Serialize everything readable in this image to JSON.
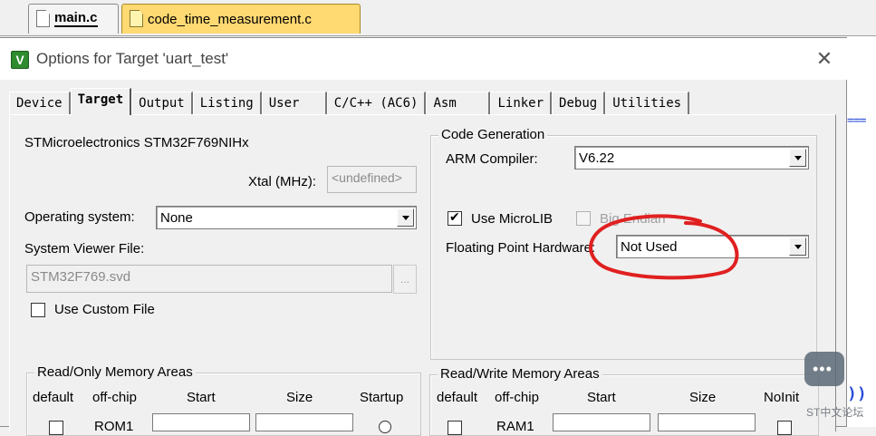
{
  "editor_tabs": [
    {
      "label": "main.c"
    },
    {
      "label": "code_time_measurement.c"
    }
  ],
  "dialog": {
    "title": "Options for Target 'uart_test'",
    "close_glyph": "✕",
    "tabs": [
      "Device",
      "Target",
      "Output",
      "Listing",
      "User",
      "C/C++ (AC6)",
      "Asm",
      "Linker",
      "Debug",
      "Utilities"
    ],
    "active_tab": "Target"
  },
  "target": {
    "device_name": "STMicroelectronics STM32F769NIHx",
    "xtal_label": "Xtal (MHz):",
    "xtal_value": "<undefined>",
    "os_label": "Operating system:",
    "os_value": "None",
    "svd_label": "System Viewer File:",
    "svd_value": "STM32F769.svd",
    "browse_label": "...",
    "custom_file_label": "Use Custom File",
    "custom_file_checked": false
  },
  "code_generation": {
    "legend": "Code Generation",
    "compiler_label": "ARM Compiler:",
    "compiler_value": "V6.22",
    "microlib_label": "Use MicroLIB",
    "microlib_checked": true,
    "big_endian_label": "Big Endian",
    "big_endian_checked": false,
    "fph_label": "Floating Point Hardware:",
    "fph_value": "Not Used"
  },
  "ro_memory": {
    "legend": "Read/Only Memory Areas",
    "headers": [
      "default",
      "off-chip",
      "Start",
      "Size",
      "Startup"
    ],
    "rows": [
      {
        "name": "ROM1"
      }
    ]
  },
  "rw_memory": {
    "legend": "Read/Write Memory Areas",
    "headers": [
      "default",
      "off-chip",
      "Start",
      "Size",
      "NoInit"
    ],
    "rows": [
      {
        "name": "RAM1"
      }
    ]
  },
  "watermark": {
    "text": "ST中文论坛"
  },
  "colors": {
    "annotation": "#e02020",
    "active_file_tab": "#ffd972"
  }
}
